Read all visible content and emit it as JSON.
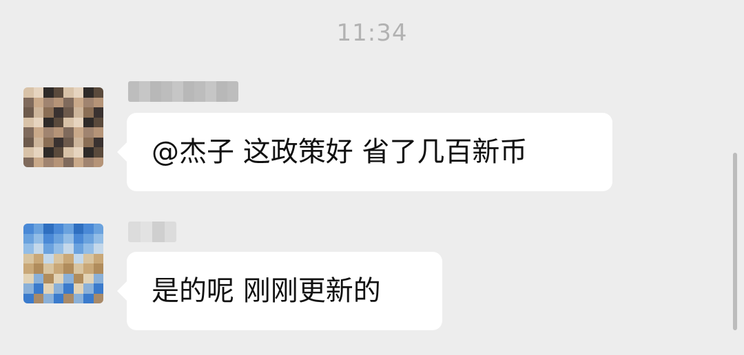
{
  "chat": {
    "timestamp": "11:34",
    "messages": [
      {
        "text": "@杰子 这政策好 省了几百新币"
      },
      {
        "text": "是的呢 刚刚更新的"
      }
    ]
  },
  "colors": {
    "background": "#ededed",
    "bubble": "#ffffff",
    "timestamp": "#b2b2b2"
  }
}
